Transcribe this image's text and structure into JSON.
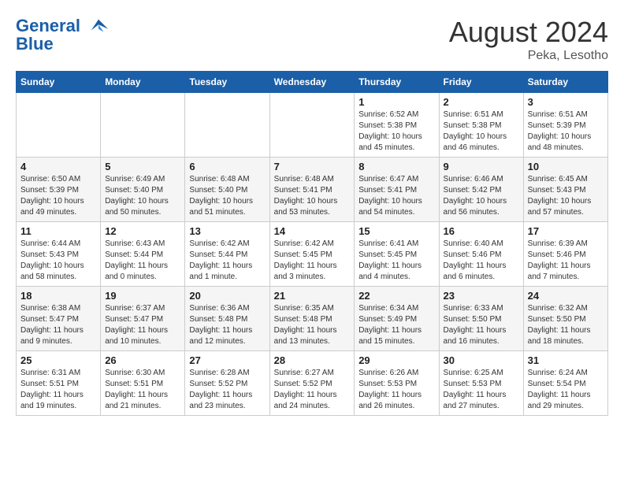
{
  "header": {
    "logo_line1": "General",
    "logo_line2": "Blue",
    "month_year": "August 2024",
    "location": "Peka, Lesotho"
  },
  "weekdays": [
    "Sunday",
    "Monday",
    "Tuesday",
    "Wednesday",
    "Thursday",
    "Friday",
    "Saturday"
  ],
  "weeks": [
    [
      {
        "day": "",
        "sunrise": "",
        "sunset": "",
        "daylight": ""
      },
      {
        "day": "",
        "sunrise": "",
        "sunset": "",
        "daylight": ""
      },
      {
        "day": "",
        "sunrise": "",
        "sunset": "",
        "daylight": ""
      },
      {
        "day": "",
        "sunrise": "",
        "sunset": "",
        "daylight": ""
      },
      {
        "day": "1",
        "sunrise": "Sunrise: 6:52 AM",
        "sunset": "Sunset: 5:38 PM",
        "daylight": "Daylight: 10 hours and 45 minutes."
      },
      {
        "day": "2",
        "sunrise": "Sunrise: 6:51 AM",
        "sunset": "Sunset: 5:38 PM",
        "daylight": "Daylight: 10 hours and 46 minutes."
      },
      {
        "day": "3",
        "sunrise": "Sunrise: 6:51 AM",
        "sunset": "Sunset: 5:39 PM",
        "daylight": "Daylight: 10 hours and 48 minutes."
      }
    ],
    [
      {
        "day": "4",
        "sunrise": "Sunrise: 6:50 AM",
        "sunset": "Sunset: 5:39 PM",
        "daylight": "Daylight: 10 hours and 49 minutes."
      },
      {
        "day": "5",
        "sunrise": "Sunrise: 6:49 AM",
        "sunset": "Sunset: 5:40 PM",
        "daylight": "Daylight: 10 hours and 50 minutes."
      },
      {
        "day": "6",
        "sunrise": "Sunrise: 6:48 AM",
        "sunset": "Sunset: 5:40 PM",
        "daylight": "Daylight: 10 hours and 51 minutes."
      },
      {
        "day": "7",
        "sunrise": "Sunrise: 6:48 AM",
        "sunset": "Sunset: 5:41 PM",
        "daylight": "Daylight: 10 hours and 53 minutes."
      },
      {
        "day": "8",
        "sunrise": "Sunrise: 6:47 AM",
        "sunset": "Sunset: 5:41 PM",
        "daylight": "Daylight: 10 hours and 54 minutes."
      },
      {
        "day": "9",
        "sunrise": "Sunrise: 6:46 AM",
        "sunset": "Sunset: 5:42 PM",
        "daylight": "Daylight: 10 hours and 56 minutes."
      },
      {
        "day": "10",
        "sunrise": "Sunrise: 6:45 AM",
        "sunset": "Sunset: 5:43 PM",
        "daylight": "Daylight: 10 hours and 57 minutes."
      }
    ],
    [
      {
        "day": "11",
        "sunrise": "Sunrise: 6:44 AM",
        "sunset": "Sunset: 5:43 PM",
        "daylight": "Daylight: 10 hours and 58 minutes."
      },
      {
        "day": "12",
        "sunrise": "Sunrise: 6:43 AM",
        "sunset": "Sunset: 5:44 PM",
        "daylight": "Daylight: 11 hours and 0 minutes."
      },
      {
        "day": "13",
        "sunrise": "Sunrise: 6:42 AM",
        "sunset": "Sunset: 5:44 PM",
        "daylight": "Daylight: 11 hours and 1 minute."
      },
      {
        "day": "14",
        "sunrise": "Sunrise: 6:42 AM",
        "sunset": "Sunset: 5:45 PM",
        "daylight": "Daylight: 11 hours and 3 minutes."
      },
      {
        "day": "15",
        "sunrise": "Sunrise: 6:41 AM",
        "sunset": "Sunset: 5:45 PM",
        "daylight": "Daylight: 11 hours and 4 minutes."
      },
      {
        "day": "16",
        "sunrise": "Sunrise: 6:40 AM",
        "sunset": "Sunset: 5:46 PM",
        "daylight": "Daylight: 11 hours and 6 minutes."
      },
      {
        "day": "17",
        "sunrise": "Sunrise: 6:39 AM",
        "sunset": "Sunset: 5:46 PM",
        "daylight": "Daylight: 11 hours and 7 minutes."
      }
    ],
    [
      {
        "day": "18",
        "sunrise": "Sunrise: 6:38 AM",
        "sunset": "Sunset: 5:47 PM",
        "daylight": "Daylight: 11 hours and 9 minutes."
      },
      {
        "day": "19",
        "sunrise": "Sunrise: 6:37 AM",
        "sunset": "Sunset: 5:47 PM",
        "daylight": "Daylight: 11 hours and 10 minutes."
      },
      {
        "day": "20",
        "sunrise": "Sunrise: 6:36 AM",
        "sunset": "Sunset: 5:48 PM",
        "daylight": "Daylight: 11 hours and 12 minutes."
      },
      {
        "day": "21",
        "sunrise": "Sunrise: 6:35 AM",
        "sunset": "Sunset: 5:48 PM",
        "daylight": "Daylight: 11 hours and 13 minutes."
      },
      {
        "day": "22",
        "sunrise": "Sunrise: 6:34 AM",
        "sunset": "Sunset: 5:49 PM",
        "daylight": "Daylight: 11 hours and 15 minutes."
      },
      {
        "day": "23",
        "sunrise": "Sunrise: 6:33 AM",
        "sunset": "Sunset: 5:50 PM",
        "daylight": "Daylight: 11 hours and 16 minutes."
      },
      {
        "day": "24",
        "sunrise": "Sunrise: 6:32 AM",
        "sunset": "Sunset: 5:50 PM",
        "daylight": "Daylight: 11 hours and 18 minutes."
      }
    ],
    [
      {
        "day": "25",
        "sunrise": "Sunrise: 6:31 AM",
        "sunset": "Sunset: 5:51 PM",
        "daylight": "Daylight: 11 hours and 19 minutes."
      },
      {
        "day": "26",
        "sunrise": "Sunrise: 6:30 AM",
        "sunset": "Sunset: 5:51 PM",
        "daylight": "Daylight: 11 hours and 21 minutes."
      },
      {
        "day": "27",
        "sunrise": "Sunrise: 6:28 AM",
        "sunset": "Sunset: 5:52 PM",
        "daylight": "Daylight: 11 hours and 23 minutes."
      },
      {
        "day": "28",
        "sunrise": "Sunrise: 6:27 AM",
        "sunset": "Sunset: 5:52 PM",
        "daylight": "Daylight: 11 hours and 24 minutes."
      },
      {
        "day": "29",
        "sunrise": "Sunrise: 6:26 AM",
        "sunset": "Sunset: 5:53 PM",
        "daylight": "Daylight: 11 hours and 26 minutes."
      },
      {
        "day": "30",
        "sunrise": "Sunrise: 6:25 AM",
        "sunset": "Sunset: 5:53 PM",
        "daylight": "Daylight: 11 hours and 27 minutes."
      },
      {
        "day": "31",
        "sunrise": "Sunrise: 6:24 AM",
        "sunset": "Sunset: 5:54 PM",
        "daylight": "Daylight: 11 hours and 29 minutes."
      }
    ]
  ]
}
